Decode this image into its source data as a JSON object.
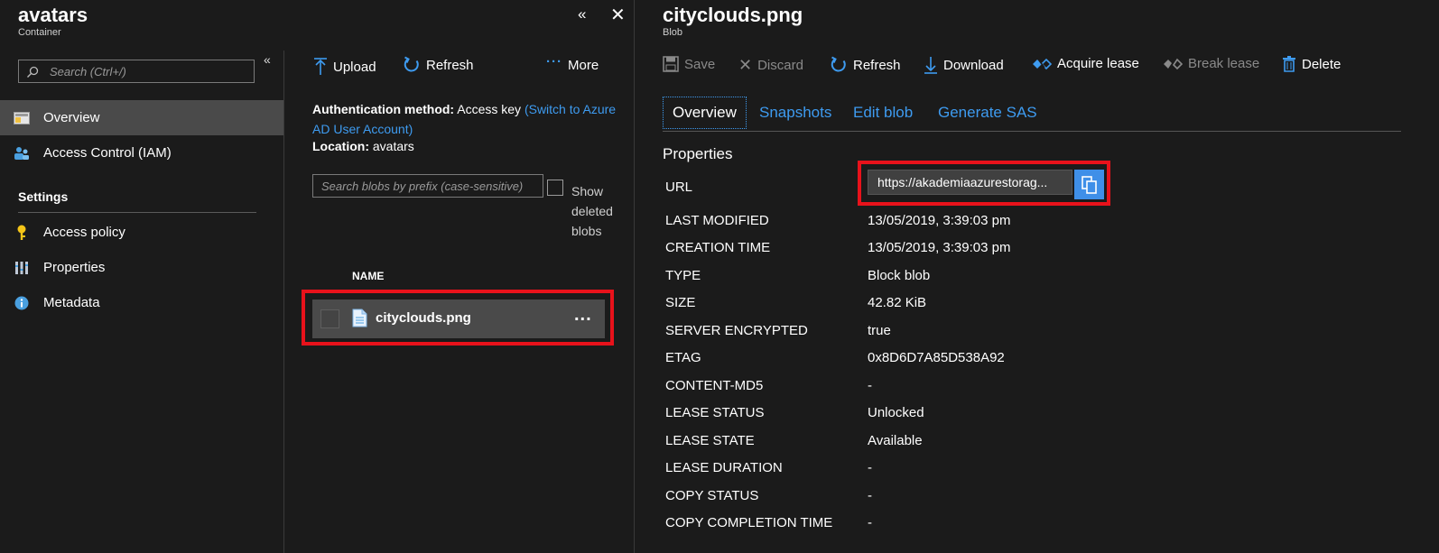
{
  "left_blade": {
    "title": "avatars",
    "subtitle": "Container",
    "search_placeholder": "Search (Ctrl+/)",
    "nav_items": [
      {
        "label": "Overview",
        "icon": "overview-icon"
      },
      {
        "label": "Access Control (IAM)",
        "icon": "iam-icon"
      }
    ],
    "settings_heading": "Settings",
    "settings_items": [
      {
        "label": "Access policy",
        "icon": "key-icon"
      },
      {
        "label": "Properties",
        "icon": "properties-icon"
      },
      {
        "label": "Metadata",
        "icon": "info-icon"
      }
    ]
  },
  "container_pane": {
    "toolbar": {
      "upload": "Upload",
      "refresh": "Refresh",
      "more": "More"
    },
    "auth_label": "Authentication method:",
    "auth_value": "Access key",
    "auth_link": "(Switch to Azure AD User Account)",
    "location_label": "Location:",
    "location_value": "avatars",
    "blob_search_placeholder": "Search blobs by prefix (case-sensitive)",
    "show_deleted_label": "Show deleted blobs",
    "column_name": "NAME",
    "blobs": [
      {
        "name": "cityclouds.png",
        "more": "..."
      }
    ]
  },
  "blob_blade": {
    "title": "cityclouds.png",
    "subtitle": "Blob",
    "toolbar": {
      "save": "Save",
      "discard": "Discard",
      "refresh": "Refresh",
      "download": "Download",
      "acquire_lease": "Acquire lease",
      "break_lease": "Break lease",
      "delete": "Delete"
    },
    "tabs": [
      "Overview",
      "Snapshots",
      "Edit blob",
      "Generate SAS"
    ],
    "properties_heading": "Properties",
    "url_label": "URL",
    "url_value": "https://akademiaazurestorag...",
    "properties": [
      {
        "label": "LAST MODIFIED",
        "value": "13/05/2019, 3:39:03 pm"
      },
      {
        "label": "CREATION TIME",
        "value": "13/05/2019, 3:39:03 pm"
      },
      {
        "label": "TYPE",
        "value": "Block blob"
      },
      {
        "label": "SIZE",
        "value": "42.82 KiB"
      },
      {
        "label": "SERVER ENCRYPTED",
        "value": "true"
      },
      {
        "label": "ETAG",
        "value": "0x8D6D7A85D538A92"
      },
      {
        "label": "CONTENT-MD5",
        "value": "-"
      },
      {
        "label": "LEASE STATUS",
        "value": "Unlocked"
      },
      {
        "label": "LEASE STATE",
        "value": "Available"
      },
      {
        "label": "LEASE DURATION",
        "value": "-"
      },
      {
        "label": "COPY STATUS",
        "value": "-"
      },
      {
        "label": "COPY COMPLETION TIME",
        "value": "-"
      }
    ]
  },
  "colors": {
    "background": "#1b1b1b",
    "accent": "#3e9bf0",
    "highlight_box": "#e8121b",
    "selected_row": "#4a4a4a"
  }
}
